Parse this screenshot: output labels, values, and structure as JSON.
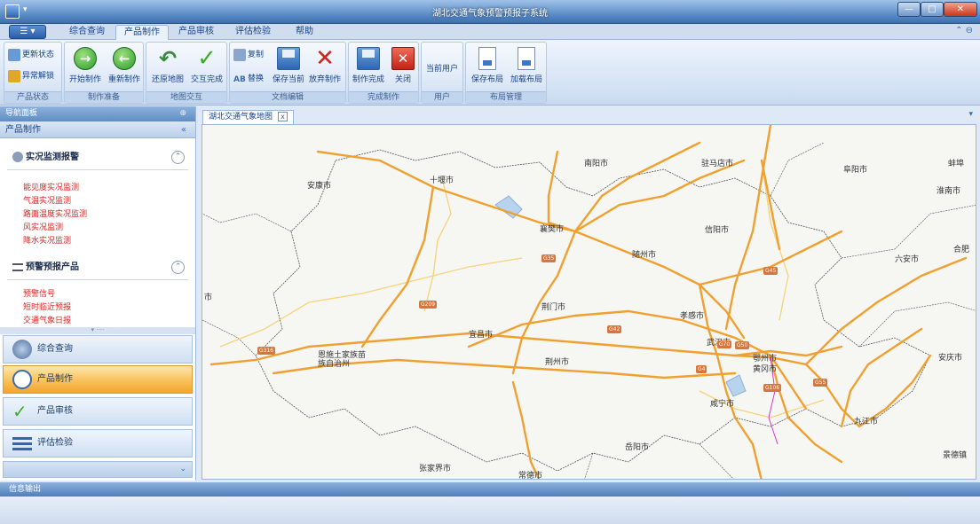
{
  "window": {
    "title": "湖北交通气象预警预报子系统",
    "app_button": "☰ ▾",
    "min": "—",
    "max": "□",
    "close": "✕"
  },
  "ribbon_tabs": [
    {
      "label": "综合查询",
      "active": false
    },
    {
      "label": "产品制作",
      "active": true
    },
    {
      "label": "产品审核",
      "active": false
    },
    {
      "label": "评估检验",
      "active": false
    },
    {
      "label": "帮助",
      "active": false
    }
  ],
  "ribbon": {
    "groups": {
      "status": "产品状态",
      "prepare": "制作准备",
      "map": "地图交互",
      "docedit": "文档编辑",
      "done": "完成制作",
      "user": "用户",
      "layout": "布局管理"
    },
    "buttons": {
      "update_status": "更新状态",
      "abnormal_unlock": "异常解锁",
      "start_make": "开始制作",
      "remake": "重新制作",
      "restore_map": "还原地图",
      "interact_done": "交互完成",
      "copy": "复制",
      "replace": "替换",
      "save_current": "保存当前",
      "discard": "放弃制作",
      "finish": "制作完成",
      "close": "关闭",
      "current_user": "当前用户",
      "save_layout": "保存布局",
      "load_layout": "加载布局"
    }
  },
  "nav": {
    "header": "导航面板",
    "pin": "⊕",
    "sub_title": "产品制作",
    "collapse": "«",
    "sections": [
      {
        "title": "实况监测报警",
        "items": [
          "能见度实况监测",
          "气温实况监测",
          "路面温度实况监测",
          "风实况监测",
          "降水实况监测"
        ]
      },
      {
        "title": "预警预报产品",
        "items": [
          "预警信号",
          "短时临近预报",
          "交通气象日报"
        ]
      }
    ],
    "up_arrow": "⌃",
    "buttons": [
      "综合查询",
      "产品制作",
      "产品审核",
      "评估检验"
    ],
    "active_button": "产品制作",
    "footer": "⌄"
  },
  "map": {
    "tab_title": "湖北交通气象地图",
    "tab_close": "x",
    "dropdown": "▾",
    "cities": [
      {
        "name": "南阳市"
      },
      {
        "name": "驻马店市"
      },
      {
        "name": "阜阳市"
      },
      {
        "name": "蚌埠"
      },
      {
        "name": "安康市"
      },
      {
        "name": "十堰市"
      },
      {
        "name": "淮南市"
      },
      {
        "name": "襄樊市"
      },
      {
        "name": "信阳市"
      },
      {
        "name": "随州市"
      },
      {
        "name": "六安市"
      },
      {
        "name": "合肥"
      },
      {
        "name": "市"
      },
      {
        "name": "荆门市"
      },
      {
        "name": "孝感市"
      },
      {
        "name": "宜昌市"
      },
      {
        "name": "武汉市"
      },
      {
        "name": "恩施土家族苗族自治州"
      },
      {
        "name": "荆州市"
      },
      {
        "name": "鄂州市"
      },
      {
        "name": "黄冈市"
      },
      {
        "name": "安庆市"
      },
      {
        "name": "咸宁市"
      },
      {
        "name": "九江市"
      },
      {
        "name": "岳阳市"
      },
      {
        "name": "景德镇"
      },
      {
        "name": "张家界市"
      },
      {
        "name": "常德市"
      }
    ],
    "road_shields": [
      "G35",
      "G45",
      "G55",
      "G42",
      "G70",
      "G50",
      "G4",
      "G106",
      "G316",
      "G209"
    ]
  },
  "status": {
    "header": "信息输出"
  },
  "colors": {
    "accent": "#15428b",
    "highway": "#f0a030",
    "link_red": "#e02121",
    "active_nav": "#f8c15a"
  }
}
